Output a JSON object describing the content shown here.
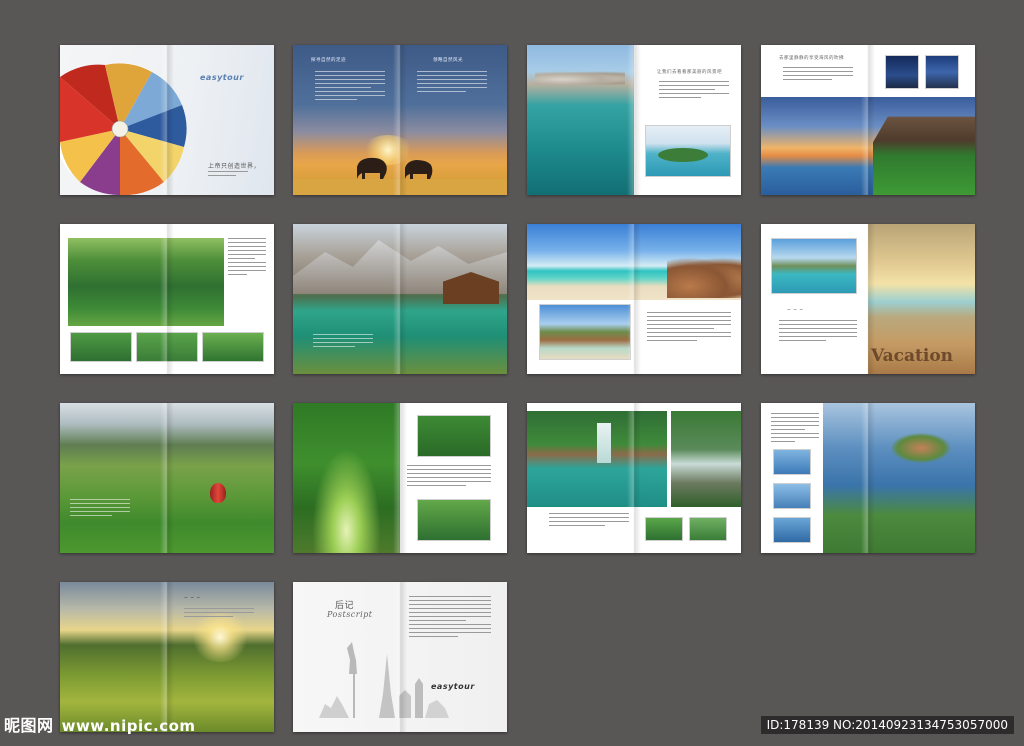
{
  "spreads": {
    "s1": {
      "slogan": "上帝只创造世界，",
      "brand": "easytour"
    },
    "s2": {
      "heading_left": "探寻自然的足迹",
      "heading_right": "领略自然风光"
    },
    "s3": {
      "heading": "让我们去看看那美丽的风景吧"
    },
    "s4": {
      "heading": "去那里静静的享受海风的吹拂"
    },
    "s8": {
      "brand_text": "Vacation"
    },
    "s14": {
      "title_cn": "后记",
      "title_en": "Postscript",
      "brand": "easytour"
    }
  },
  "footer": {
    "site_cn": "昵图网",
    "site_url": "www.nipic.com",
    "id_text": "ID:178139 NO:20140923134753057000"
  }
}
